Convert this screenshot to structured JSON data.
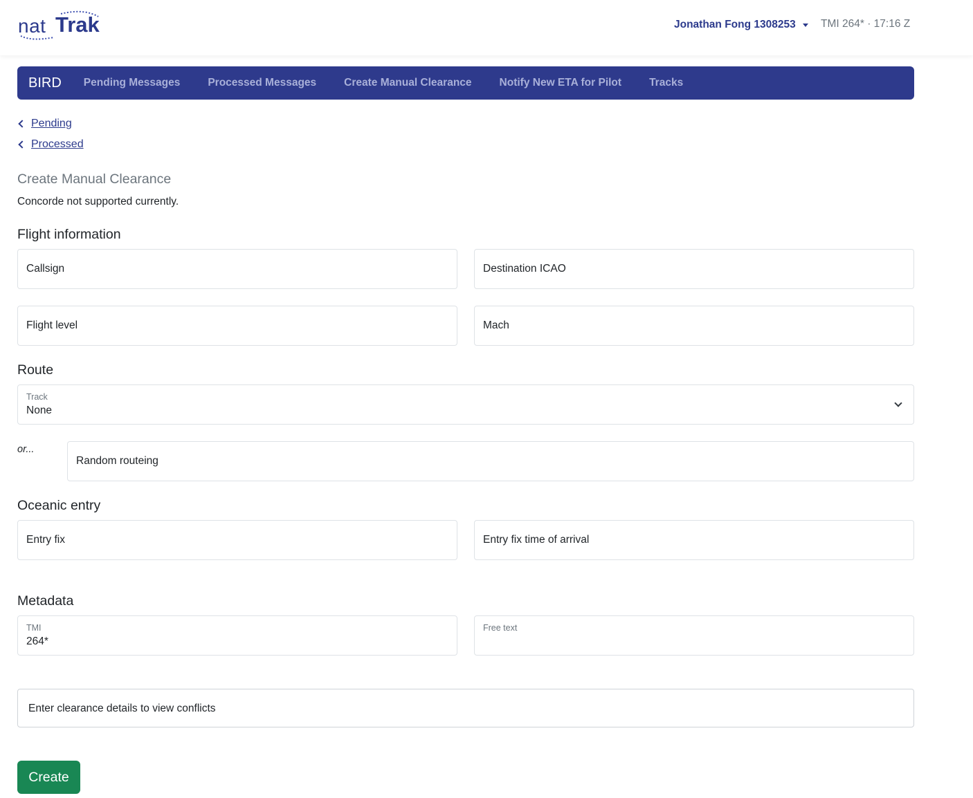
{
  "header": {
    "logo_nat": "nat",
    "logo_trak": "Trak",
    "user": "Jonathan Fong 1308253",
    "tmi_time": "TMI 264* · 17:16 Z"
  },
  "navbar": {
    "brand": "BIRD",
    "items": [
      {
        "label": "Pending Messages"
      },
      {
        "label": "Processed Messages"
      },
      {
        "label": "Create Manual Clearance"
      },
      {
        "label": "Notify New ETA for Pilot"
      },
      {
        "label": "Tracks"
      }
    ]
  },
  "breadcrumbs": [
    {
      "label": "Pending"
    },
    {
      "label": "Processed"
    }
  ],
  "page": {
    "title": "Create Manual Clearance",
    "note": "Concorde not supported currently."
  },
  "sections": {
    "flight_info": "Flight information",
    "route": "Route",
    "oceanic_entry": "Oceanic entry",
    "metadata": "Metadata"
  },
  "fields": {
    "callsign": {
      "placeholder": "Callsign",
      "value": ""
    },
    "destination": {
      "placeholder": "Destination ICAO",
      "value": ""
    },
    "flight_level": {
      "placeholder": "Flight level",
      "value": ""
    },
    "mach": {
      "placeholder": "Mach",
      "value": ""
    },
    "track": {
      "label": "Track",
      "selected": "None"
    },
    "or_label": "or...",
    "random_routeing": {
      "placeholder": "Random routeing",
      "value": ""
    },
    "entry_fix": {
      "placeholder": "Entry fix",
      "value": ""
    },
    "entry_fix_time": {
      "placeholder": "Entry fix time of arrival",
      "value": ""
    },
    "tmi": {
      "label": "TMI",
      "value": "264*"
    },
    "free_text": {
      "label": "Free text",
      "value": ""
    }
  },
  "conflicts": {
    "message": "Enter clearance details to view conflicts"
  },
  "actions": {
    "create_label": "Create"
  },
  "colors": {
    "brand": "#2e3a8c",
    "nav_inactive": "#a9b0d9",
    "primary_button": "#198754",
    "muted": "#6c757d"
  }
}
